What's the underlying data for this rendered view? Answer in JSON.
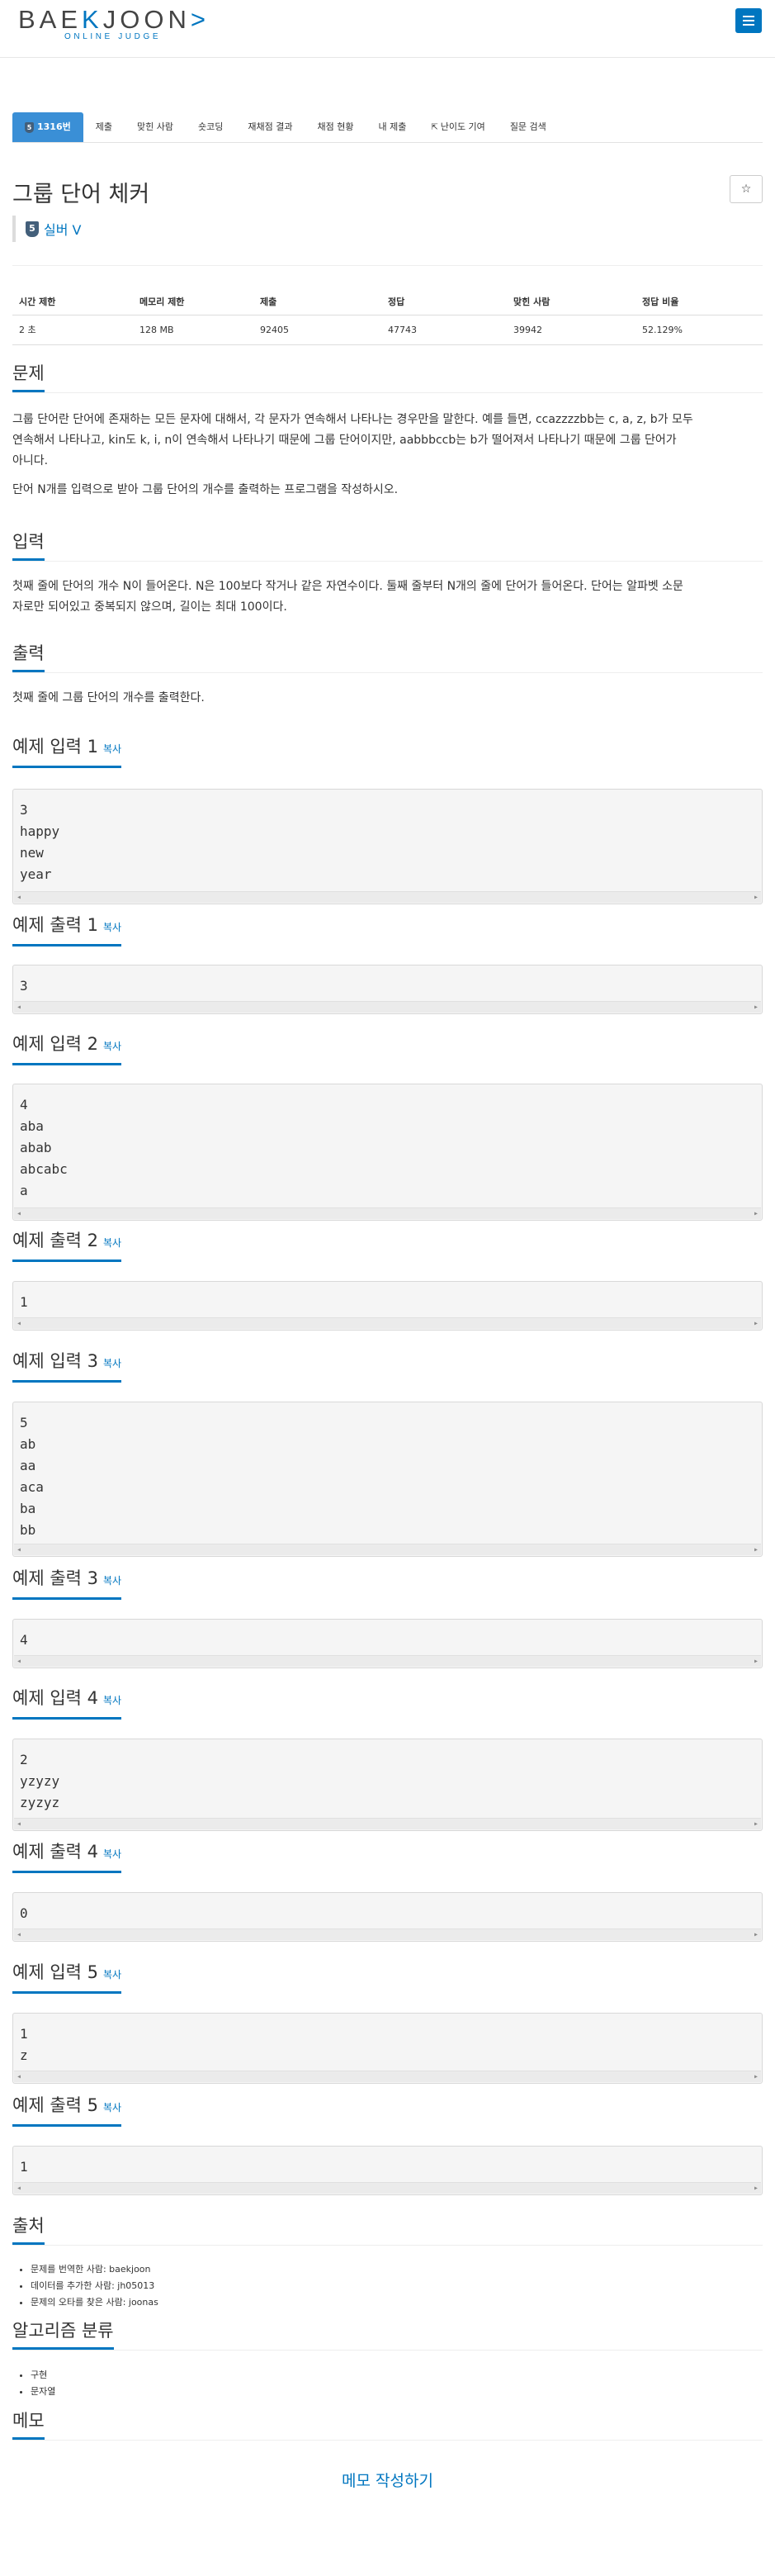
{
  "header": {
    "logo_prefix": "BAE",
    "logo_k": "K",
    "logo_suffix": "JOON",
    "logo_arrow": ">",
    "logo_sub": "ONLINE JUDGE",
    "brand_color": "#0076c0"
  },
  "tabs": [
    {
      "label": "1316번",
      "tier": "5",
      "active": true
    },
    {
      "label": "제출"
    },
    {
      "label": "맞힌 사람"
    },
    {
      "label": "숏코딩"
    },
    {
      "label": "재채점 결과"
    },
    {
      "label": "채점 현황"
    },
    {
      "label": "내 제출"
    },
    {
      "label": "난이도 기여",
      "icon": "external-link-icon"
    },
    {
      "label": "질문 검색"
    }
  ],
  "problem": {
    "title": "그룹 단어 체커",
    "tier_num": "5",
    "tier_label": "실버 V",
    "star": "☆"
  },
  "info": {
    "headers": [
      "시간 제한",
      "메모리 제한",
      "제출",
      "정답",
      "맞힌 사람",
      "정답 비율"
    ],
    "values": [
      "2 초",
      "128 MB",
      "92405",
      "47743",
      "39942",
      "52.129%"
    ]
  },
  "sections": {
    "problem_title": "문제",
    "problem_p1a": "그룹 단어란 단어에 존재하는 모든 문자에 대해서, 각 문자가 연속해서 나타나는 경우만을 말한다. 예를 들면, ccazzzzbb는 c, a, z, b가 모두",
    "problem_p1b": "연속해서 나타나고, kin도 k, i, n이 연속해서 나타나기 때문에 그룹 단어이지만, aabbbccb는 b가 떨어져서 나타나기 때문에 그룹 단어가",
    "problem_p1c": "아니다.",
    "problem_p2": "단어 N개를 입력으로 받아 그룹 단어의 개수를 출력하는 프로그램을 작성하시오.",
    "input_title": "입력",
    "input_p1": "첫째 줄에 단어의 개수 N이 들어온다. N은 100보다 작거나 같은 자연수이다. 둘째 줄부터 N개의 줄에 단어가 들어온다. 단어는 알파벳 소문",
    "input_p2": "자로만 되어있고 중복되지 않으며, 길이는 최대 100이다.",
    "output_title": "출력",
    "output_p1": "첫째 줄에 그룹 단어의 개수를 출력한다.",
    "copy_label": "복사"
  },
  "samples": [
    {
      "in_title": "예제 입력 1",
      "in_lines": [
        "3",
        "happy",
        "new",
        "year"
      ],
      "out_title": "예제 출력 1",
      "out_lines": [
        "3"
      ]
    },
    {
      "in_title": "예제 입력 2",
      "in_lines": [
        "4",
        "aba",
        "abab",
        "abcabc",
        "a"
      ],
      "out_title": "예제 출력 2",
      "out_lines": [
        "1"
      ]
    },
    {
      "in_title": "예제 입력 3",
      "in_lines": [
        "5",
        "ab",
        "aa",
        "aca",
        "ba",
        "bb"
      ],
      "out_title": "예제 출력 3",
      "out_lines": [
        "4"
      ]
    },
    {
      "in_title": "예제 입력 4",
      "in_lines": [
        "2",
        "yzyzy",
        "zyzyz"
      ],
      "out_title": "예제 출력 4",
      "out_lines": [
        "0"
      ]
    },
    {
      "in_title": "예제 입력 5",
      "in_lines": [
        "1",
        "z"
      ],
      "out_title": "예제 출력 5",
      "out_lines": [
        "1"
      ]
    }
  ],
  "source": {
    "title": "출처",
    "items": [
      "문제를 번역한 사람: baekjoon",
      "데이터를 추가한 사람: jh05013",
      "문제의 오타를 찾은 사람: joonas"
    ]
  },
  "algorithms": {
    "title": "알고리즘 분류",
    "items": [
      "구현",
      "문자열"
    ]
  },
  "memo": {
    "title": "메모",
    "link": "메모 작성하기"
  }
}
